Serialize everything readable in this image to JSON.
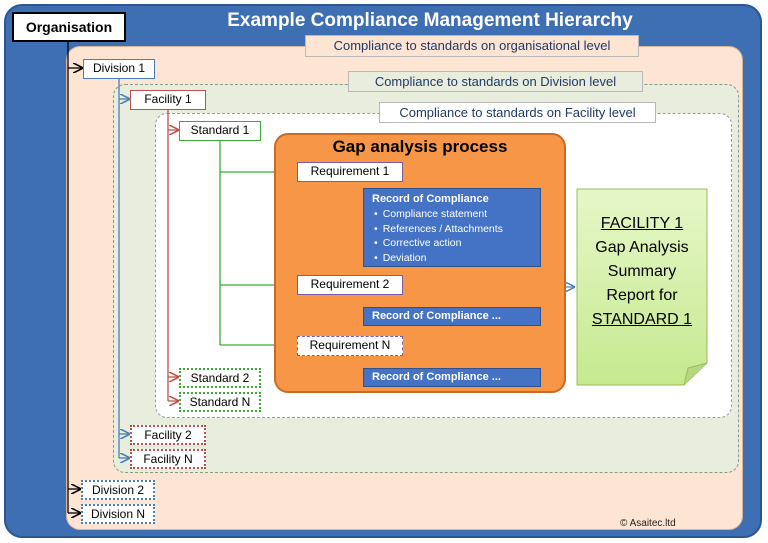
{
  "title": "Example Compliance Management Hierarchy",
  "organisation": "Organisation",
  "levels": {
    "org": "Compliance to standards on organisational level",
    "division": "Compliance to standards on Division level",
    "facility": "Compliance to standards on Facility  level"
  },
  "divisions": [
    "Division 1",
    "Division 2",
    "Division N"
  ],
  "facilities": [
    "Facility 1",
    "Facility 2",
    "Facility N"
  ],
  "standards": [
    "Standard 1",
    "Standard 2",
    "Standard N"
  ],
  "gap": {
    "title": "Gap analysis process",
    "requirements": [
      "Requirement 1",
      "Requirement 2",
      "Requirement N"
    ],
    "record_title": "Record of Compliance",
    "record_items": [
      "Compliance statement",
      "References / Attachments",
      "Corrective action",
      "Deviation"
    ],
    "record_short": "Record of Compliance ..."
  },
  "report": {
    "line1": "FACILITY 1",
    "line2": "Gap Analysis",
    "line3": "Summary",
    "line4": "Report for",
    "line5": "STANDARD 1"
  },
  "copyright": "©  Asaitec.ltd",
  "colors": {
    "division": "#4a7ebb",
    "facility": "#c0504d",
    "standard": "#3aaa35",
    "requirement": "#7f5aa6",
    "record": "#4472c4",
    "gap_panel": "#f79646"
  }
}
